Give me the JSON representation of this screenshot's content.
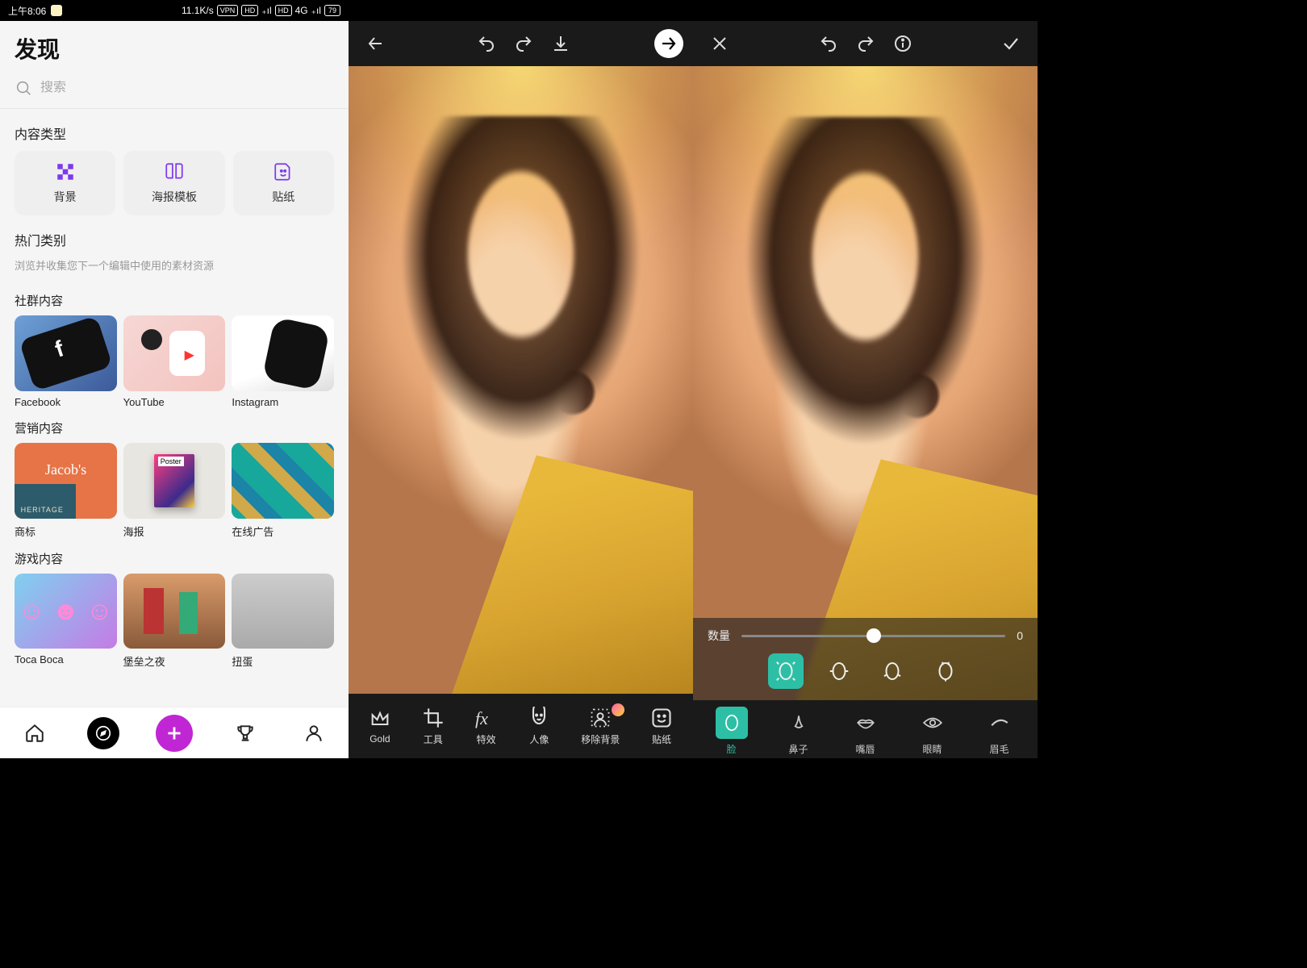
{
  "status": {
    "time": "上午8:06",
    "speed": "11.1K/s",
    "vpn": "VPN",
    "hd": "HD",
    "net": "4G",
    "battery": "79"
  },
  "panel1": {
    "title": "发现",
    "search_placeholder": "搜索",
    "section_content_types": "内容类型",
    "chips": {
      "background": "背景",
      "poster_template": "海报模板",
      "sticker": "贴纸"
    },
    "section_popular": "热门类别",
    "section_popular_sub": "浏览并收集您下一个编辑中使用的素材资源",
    "group_community": "社群内容",
    "community": {
      "facebook": "Facebook",
      "youtube": "YouTube",
      "instagram": "Instagram"
    },
    "group_marketing": "营销内容",
    "marketing": {
      "logo": "商标",
      "poster": "海报",
      "online_ads": "在线广告"
    },
    "group_game": "游戏内容",
    "game": {
      "toca": "Toca Boca",
      "fortnite": "堡垒之夜",
      "twist_egg": "扭蛋"
    }
  },
  "panel2": {
    "tools": {
      "gold": "Gold",
      "tools": "工具",
      "fx": "特效",
      "portrait": "人像",
      "remove_bg": "移除背景",
      "sticker": "贴纸"
    }
  },
  "panel3": {
    "slider_label": "数量",
    "slider_value": "0",
    "face_tools": {
      "face": "脸",
      "nose": "鼻子",
      "lips": "嘴唇",
      "eyes": "眼睛",
      "brows": "眉毛"
    }
  },
  "colors": {
    "accent_purple": "#7c3aed",
    "fab_magenta": "#c026d3",
    "teal": "#2dbfa6"
  }
}
